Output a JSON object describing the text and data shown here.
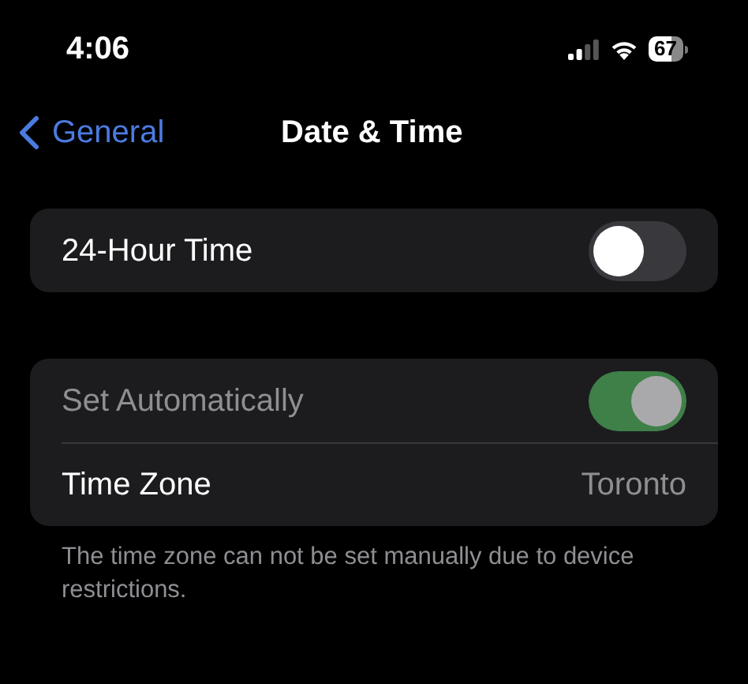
{
  "status_bar": {
    "time": "4:06",
    "battery": "67"
  },
  "nav": {
    "back": "General",
    "title": "Date & Time"
  },
  "groups": [
    {
      "rows": [
        {
          "kind": "toggle",
          "label": "24-Hour Time",
          "on": false,
          "disabled": false
        }
      ]
    },
    {
      "rows": [
        {
          "kind": "toggle",
          "label": "Set Automatically",
          "on": true,
          "disabled": true
        },
        {
          "kind": "value",
          "label": "Time Zone",
          "value": "Toronto"
        }
      ],
      "footer": "The time zone can not be set manually due to device restrictions."
    }
  ]
}
